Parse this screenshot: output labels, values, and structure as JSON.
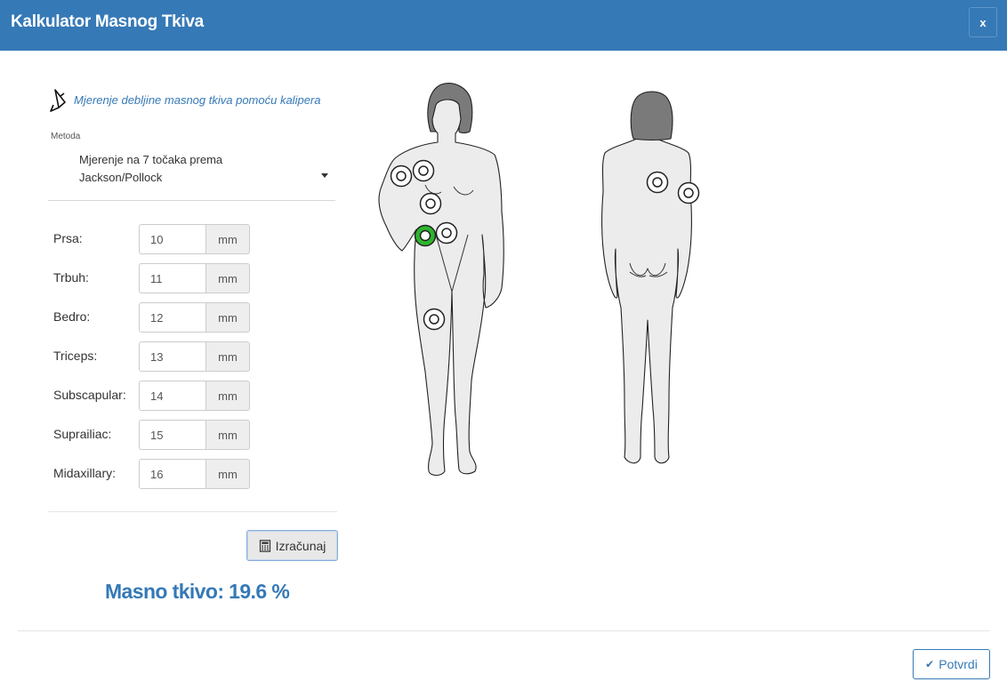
{
  "header": {
    "title": "Kalkulator Masnog Tkiva",
    "close_label": "x"
  },
  "form": {
    "caliper_link_text": "Mjerenje debljine masnog tkiva pomoću kalipera",
    "method_label": "Metoda",
    "method_value": "Mjerenje na 7 točaka prema Jackson/Pollock",
    "measurements": [
      {
        "label": "Prsa:",
        "value": "10",
        "unit": "mm"
      },
      {
        "label": "Trbuh:",
        "value": "11",
        "unit": "mm"
      },
      {
        "label": "Bedro:",
        "value": "12",
        "unit": "mm"
      },
      {
        "label": "Triceps:",
        "value": "13",
        "unit": "mm"
      },
      {
        "label": "Subscapular:",
        "value": "14",
        "unit": "mm"
      },
      {
        "label": "Suprailiac:",
        "value": "15",
        "unit": "mm"
      },
      {
        "label": "Midaxillary:",
        "value": "16",
        "unit": "mm"
      }
    ],
    "calculate_label": "Izračunaj",
    "result_text": "Masno tkivo: 19.6 %"
  },
  "footer": {
    "confirm_label": "Potvrdi"
  },
  "colors": {
    "header": "#3579b6",
    "accent": "#3579b6",
    "active_marker": "#2db52d"
  }
}
